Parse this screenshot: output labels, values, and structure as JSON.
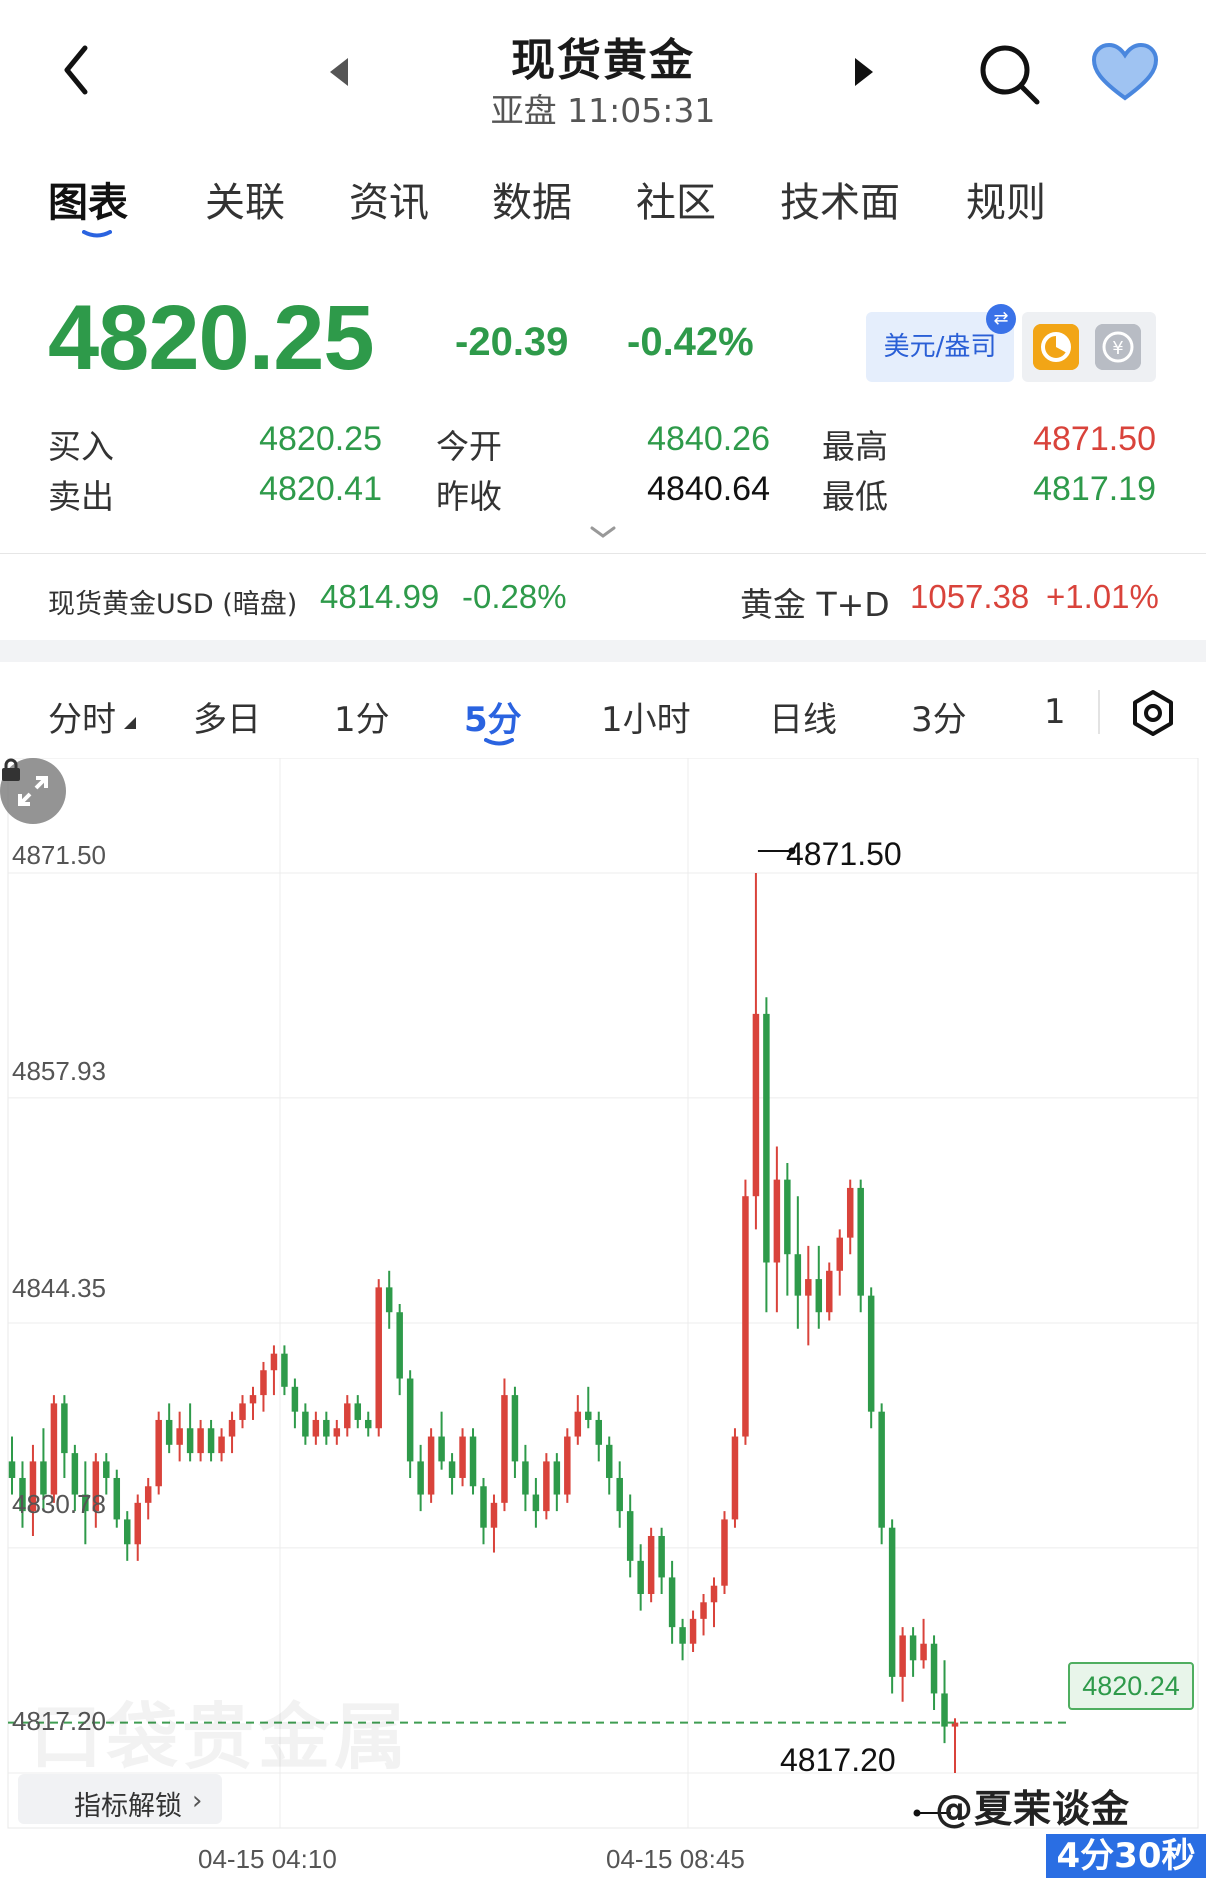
{
  "header": {
    "title": "现货黄金",
    "subtitle": "亚盘 11:05:31"
  },
  "tabs": [
    "图表",
    "关联",
    "资讯",
    "数据",
    "社区",
    "技术面",
    "规则"
  ],
  "quote": {
    "price": "4820.25",
    "change": "-20.39",
    "change_pct": "-0.42%",
    "unit_toggle": "美元/盎司",
    "stats": [
      {
        "label": "买入",
        "value": "4820.25",
        "color": "#2e9a4a"
      },
      {
        "label": "卖出",
        "value": "4820.41",
        "color": "#2e9a4a"
      },
      {
        "label": "今开",
        "value": "4840.26",
        "color": "#2e9a4a"
      },
      {
        "label": "昨收",
        "value": "4840.64",
        "color": "#111111"
      },
      {
        "label": "最高",
        "value": "4871.50",
        "color": "#d9433b"
      },
      {
        "label": "最低",
        "value": "4817.19",
        "color": "#2e9a4a"
      }
    ]
  },
  "tickers": {
    "a_label": "现货黄金USD (暗盘)",
    "a_value": "4814.99",
    "a_pct": "-0.28%",
    "b_label": "黄金 T+D",
    "b_value": "1057.38",
    "b_pct": "+1.01%"
  },
  "periods": [
    "分时",
    "多日",
    "1分",
    "5分",
    "1小时",
    "日线",
    "3分",
    "1"
  ],
  "active_period": "5分",
  "chart": {
    "high_label": "4871.50",
    "low_label": "4817.20",
    "current_tag": "4820.24",
    "watermark": "口袋贵金属",
    "lock_label": "指标解锁",
    "credit": "@夏茉谈金",
    "countdown": "4分30秒"
  },
  "chart_data": {
    "type": "candlestick",
    "title": "",
    "y_ticks": [
      "4871.50",
      "4857.93",
      "4844.35",
      "4830.78",
      "4817.20"
    ],
    "x_ticks": [
      "04-15 04:10",
      "04-15 08:45"
    ],
    "ylim": [
      4817.2,
      4871.5
    ],
    "up_color": "#d9433b",
    "down_color": "#2e9a4a",
    "current_price_line": 4820.24,
    "candles": [
      [
        4836.0,
        4837.5,
        4834.0,
        4835.0
      ],
      [
        4835.0,
        4836.0,
        4832.0,
        4833.0
      ],
      [
        4833.0,
        4837.0,
        4831.5,
        4836.0
      ],
      [
        4836.0,
        4838.0,
        4833.0,
        4834.0
      ],
      [
        4834.0,
        4840.0,
        4833.5,
        4839.5
      ],
      [
        4839.5,
        4840.0,
        4835.0,
        4836.5
      ],
      [
        4836.5,
        4837.0,
        4833.0,
        4834.0
      ],
      [
        4834.0,
        4836.0,
        4831.0,
        4833.0
      ],
      [
        4833.0,
        4836.5,
        4832.0,
        4836.0
      ],
      [
        4836.0,
        4836.5,
        4834.0,
        4835.0
      ],
      [
        4835.0,
        4835.5,
        4832.0,
        4832.5
      ],
      [
        4832.5,
        4833.0,
        4830.0,
        4831.0
      ],
      [
        4831.0,
        4834.0,
        4830.0,
        4833.5
      ],
      [
        4833.5,
        4835.0,
        4832.5,
        4834.5
      ],
      [
        4834.5,
        4839.0,
        4834.0,
        4838.5
      ],
      [
        4838.5,
        4839.5,
        4836.5,
        4837.0
      ],
      [
        4837.0,
        4839.0,
        4836.0,
        4838.0
      ],
      [
        4838.0,
        4839.5,
        4836.0,
        4836.5
      ],
      [
        4836.5,
        4838.5,
        4836.0,
        4838.0
      ],
      [
        4838.0,
        4838.5,
        4836.0,
        4836.5
      ],
      [
        4836.5,
        4838.0,
        4836.0,
        4837.5
      ],
      [
        4837.5,
        4839.0,
        4836.5,
        4838.5
      ],
      [
        4838.5,
        4840.0,
        4838.0,
        4839.5
      ],
      [
        4839.5,
        4840.5,
        4838.5,
        4840.0
      ],
      [
        4840.0,
        4842.0,
        4839.0,
        4841.5
      ],
      [
        4841.5,
        4843.0,
        4840.0,
        4842.5
      ],
      [
        4842.5,
        4843.0,
        4840.0,
        4840.5
      ],
      [
        4840.5,
        4841.0,
        4838.0,
        4839.0
      ],
      [
        4839.0,
        4839.5,
        4837.0,
        4837.5
      ],
      [
        4837.5,
        4839.0,
        4837.0,
        4838.5
      ],
      [
        4838.5,
        4839.0,
        4837.0,
        4837.5
      ],
      [
        4837.5,
        4838.5,
        4837.0,
        4838.0
      ],
      [
        4838.0,
        4840.0,
        4837.5,
        4839.5
      ],
      [
        4839.5,
        4840.0,
        4838.0,
        4838.5
      ],
      [
        4838.5,
        4839.0,
        4837.5,
        4838.0
      ],
      [
        4838.0,
        4847.0,
        4837.5,
        4846.5
      ],
      [
        4846.5,
        4847.5,
        4844.0,
        4845.0
      ],
      [
        4845.0,
        4845.5,
        4840.0,
        4841.0
      ],
      [
        4841.0,
        4841.5,
        4835.0,
        4836.0
      ],
      [
        4836.0,
        4837.0,
        4833.0,
        4834.0
      ],
      [
        4834.0,
        4838.0,
        4833.5,
        4837.5
      ],
      [
        4837.5,
        4839.0,
        4835.5,
        4836.0
      ],
      [
        4836.0,
        4836.5,
        4834.0,
        4835.0
      ],
      [
        4835.0,
        4838.0,
        4834.5,
        4837.5
      ],
      [
        4837.5,
        4838.0,
        4834.0,
        4834.5
      ],
      [
        4834.5,
        4835.0,
        4831.0,
        4832.0
      ],
      [
        4832.0,
        4834.0,
        4830.5,
        4833.5
      ],
      [
        4833.5,
        4841.0,
        4833.0,
        4840.0
      ],
      [
        4840.0,
        4840.5,
        4835.0,
        4836.0
      ],
      [
        4836.0,
        4837.0,
        4833.0,
        4834.0
      ],
      [
        4834.0,
        4835.0,
        4832.0,
        4833.0
      ],
      [
        4833.0,
        4836.5,
        4832.5,
        4836.0
      ],
      [
        4836.0,
        4836.5,
        4833.0,
        4834.0
      ],
      [
        4834.0,
        4838.0,
        4833.5,
        4837.5
      ],
      [
        4837.5,
        4840.0,
        4837.0,
        4839.0
      ],
      [
        4839.0,
        4840.5,
        4838.0,
        4838.5
      ],
      [
        4838.5,
        4839.0,
        4836.0,
        4837.0
      ],
      [
        4837.0,
        4837.5,
        4834.0,
        4835.0
      ],
      [
        4835.0,
        4836.0,
        4832.0,
        4833.0
      ],
      [
        4833.0,
        4834.0,
        4829.0,
        4830.0
      ],
      [
        4830.0,
        4831.0,
        4827.0,
        4828.0
      ],
      [
        4828.0,
        4832.0,
        4827.5,
        4831.5
      ],
      [
        4831.5,
        4832.0,
        4828.0,
        4829.0
      ],
      [
        4829.0,
        4830.0,
        4825.0,
        4826.0
      ],
      [
        4826.0,
        4826.5,
        4824.0,
        4825.0
      ],
      [
        4825.0,
        4827.0,
        4824.5,
        4826.5
      ],
      [
        4826.5,
        4828.0,
        4825.5,
        4827.5
      ],
      [
        4827.5,
        4829.0,
        4826.0,
        4828.5
      ],
      [
        4828.5,
        4833.0,
        4828.0,
        4832.5
      ],
      [
        4832.5,
        4838.0,
        4832.0,
        4837.5
      ],
      [
        4837.5,
        4853.0,
        4837.0,
        4852.0
      ],
      [
        4852.0,
        4871.5,
        4850.0,
        4863.0
      ],
      [
        4863.0,
        4864.0,
        4845.0,
        4848.0
      ],
      [
        4848.0,
        4855.0,
        4845.0,
        4853.0
      ],
      [
        4853.0,
        4854.0,
        4846.0,
        4848.5
      ],
      [
        4848.5,
        4852.0,
        4844.0,
        4846.0
      ],
      [
        4846.0,
        4849.0,
        4843.0,
        4847.0
      ],
      [
        4847.0,
        4849.0,
        4844.0,
        4845.0
      ],
      [
        4845.0,
        4848.0,
        4844.5,
        4847.5
      ],
      [
        4847.5,
        4850.0,
        4846.0,
        4849.5
      ],
      [
        4849.5,
        4853.0,
        4848.5,
        4852.5
      ],
      [
        4852.5,
        4853.0,
        4845.0,
        4846.0
      ],
      [
        4846.0,
        4846.5,
        4838.0,
        4839.0
      ],
      [
        4839.0,
        4839.5,
        4831.0,
        4832.0
      ],
      [
        4832.0,
        4832.5,
        4822.0,
        4823.0
      ],
      [
        4823.0,
        4826.0,
        4821.5,
        4825.5
      ],
      [
        4825.5,
        4826.0,
        4823.0,
        4824.0
      ],
      [
        4824.0,
        4826.5,
        4823.5,
        4825.0
      ],
      [
        4825.0,
        4825.5,
        4821.0,
        4822.0
      ],
      [
        4822.0,
        4824.0,
        4819.0,
        4820.0
      ],
      [
        4820.0,
        4820.5,
        4817.2,
        4820.24
      ]
    ]
  }
}
